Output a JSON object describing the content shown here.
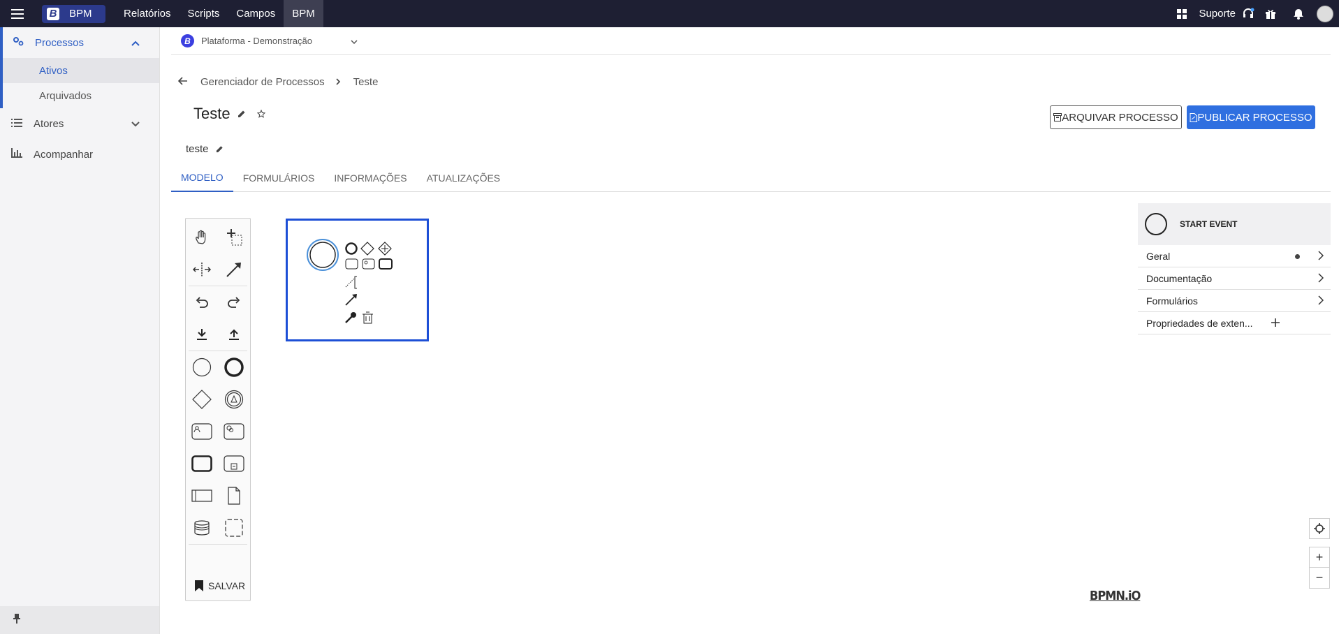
{
  "topbar": {
    "brand": "BPM",
    "brand_letter": "B",
    "nav": [
      "Relatórios",
      "Scripts",
      "Campos",
      "BPM"
    ],
    "support": "Suporte"
  },
  "sidebar": {
    "processos": "Processos",
    "ativos": "Ativos",
    "arquivados": "Arquivados",
    "atores": "Atores",
    "acompanhar": "Acompanhar"
  },
  "platform": {
    "letter": "B",
    "name": "Plataforma - Demonstração"
  },
  "breadcrumb": {
    "root": "Gerenciador de Processos",
    "current": "Teste"
  },
  "process": {
    "title": "Teste",
    "description": "teste"
  },
  "actions": {
    "archive": "ARQUIVAR PROCESSO",
    "publish": "PUBLICAR PROCESSO"
  },
  "tabs": [
    "MODELO",
    "FORMULÁRIOS",
    "INFORMAÇÕES",
    "ATUALIZAÇÕES"
  ],
  "palette": {
    "save": "SALVAR"
  },
  "properties": {
    "element": "START EVENT",
    "rows": [
      "Geral",
      "Documentação",
      "Formulários",
      "Propriedades de exten..."
    ]
  },
  "zoom": {
    "plus": "+",
    "minus": "−"
  },
  "watermark": "BPMN.iO",
  "colors": {
    "topbar": "#1e1f33",
    "accent": "#2f5fc4",
    "publish": "#2f6fe0",
    "selection": "#1d4fd6"
  }
}
